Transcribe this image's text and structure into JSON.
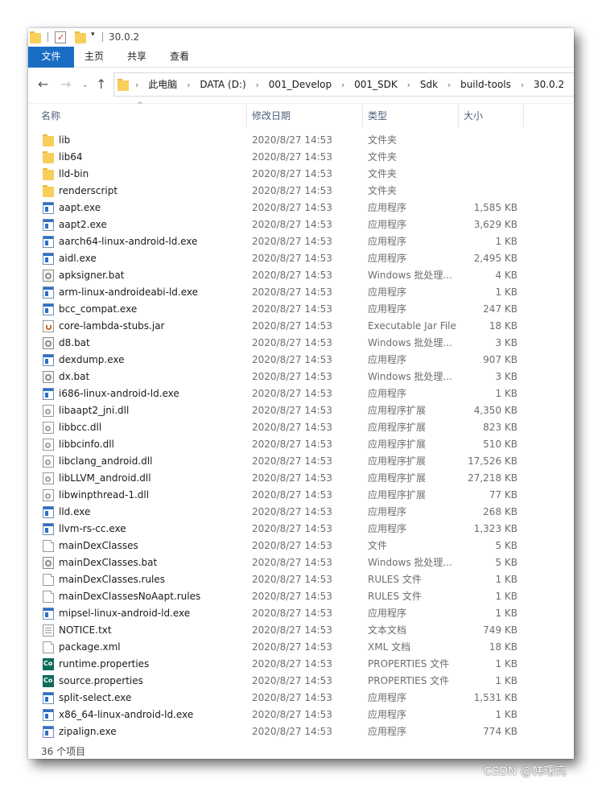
{
  "window": {
    "title": "30.0.2"
  },
  "ribbon": {
    "tabs": [
      {
        "label": "文件"
      },
      {
        "label": "主页"
      },
      {
        "label": "共享"
      },
      {
        "label": "查看"
      }
    ]
  },
  "address": {
    "crumbs": [
      "此电脑",
      "DATA (D:)",
      "001_Develop",
      "001_SDK",
      "Sdk",
      "build-tools",
      "30.0.2"
    ]
  },
  "columns": {
    "name": "名称",
    "date": "修改日期",
    "type": "类型",
    "size": "大小"
  },
  "files": [
    {
      "name": "lib",
      "date": "2020/8/27 14:53",
      "type": "文件夹",
      "size": "",
      "icon": "folder-icon"
    },
    {
      "name": "lib64",
      "date": "2020/8/27 14:53",
      "type": "文件夹",
      "size": "",
      "icon": "folder-icon"
    },
    {
      "name": "lld-bin",
      "date": "2020/8/27 14:53",
      "type": "文件夹",
      "size": "",
      "icon": "folder-icon"
    },
    {
      "name": "renderscript",
      "date": "2020/8/27 14:53",
      "type": "文件夹",
      "size": "",
      "icon": "folder-icon"
    },
    {
      "name": "aapt.exe",
      "date": "2020/8/27 14:53",
      "type": "应用程序",
      "size": "1,585 KB",
      "icon": "exe-icon"
    },
    {
      "name": "aapt2.exe",
      "date": "2020/8/27 14:53",
      "type": "应用程序",
      "size": "3,629 KB",
      "icon": "exe-icon"
    },
    {
      "name": "aarch64-linux-android-ld.exe",
      "date": "2020/8/27 14:53",
      "type": "应用程序",
      "size": "1 KB",
      "icon": "exe-icon"
    },
    {
      "name": "aidl.exe",
      "date": "2020/8/27 14:53",
      "type": "应用程序",
      "size": "2,495 KB",
      "icon": "exe-icon"
    },
    {
      "name": "apksigner.bat",
      "date": "2020/8/27 14:53",
      "type": "Windows 批处理...",
      "size": "4 KB",
      "icon": "bat-icon"
    },
    {
      "name": "arm-linux-androideabi-ld.exe",
      "date": "2020/8/27 14:53",
      "type": "应用程序",
      "size": "1 KB",
      "icon": "exe-icon"
    },
    {
      "name": "bcc_compat.exe",
      "date": "2020/8/27 14:53",
      "type": "应用程序",
      "size": "247 KB",
      "icon": "exe-icon"
    },
    {
      "name": "core-lambda-stubs.jar",
      "date": "2020/8/27 14:53",
      "type": "Executable Jar File",
      "size": "18 KB",
      "icon": "jar-icon"
    },
    {
      "name": "d8.bat",
      "date": "2020/8/27 14:53",
      "type": "Windows 批处理...",
      "size": "3 KB",
      "icon": "bat-icon"
    },
    {
      "name": "dexdump.exe",
      "date": "2020/8/27 14:53",
      "type": "应用程序",
      "size": "907 KB",
      "icon": "exe-icon"
    },
    {
      "name": "dx.bat",
      "date": "2020/8/27 14:53",
      "type": "Windows 批处理...",
      "size": "3 KB",
      "icon": "bat-icon"
    },
    {
      "name": "i686-linux-android-ld.exe",
      "date": "2020/8/27 14:53",
      "type": "应用程序",
      "size": "1 KB",
      "icon": "exe-icon"
    },
    {
      "name": "libaapt2_jni.dll",
      "date": "2020/8/27 14:53",
      "type": "应用程序扩展",
      "size": "4,350 KB",
      "icon": "dll-icon"
    },
    {
      "name": "libbcc.dll",
      "date": "2020/8/27 14:53",
      "type": "应用程序扩展",
      "size": "823 KB",
      "icon": "dll-icon"
    },
    {
      "name": "libbcinfo.dll",
      "date": "2020/8/27 14:53",
      "type": "应用程序扩展",
      "size": "510 KB",
      "icon": "dll-icon"
    },
    {
      "name": "libclang_android.dll",
      "date": "2020/8/27 14:53",
      "type": "应用程序扩展",
      "size": "17,526 KB",
      "icon": "dll-icon"
    },
    {
      "name": "libLLVM_android.dll",
      "date": "2020/8/27 14:53",
      "type": "应用程序扩展",
      "size": "27,218 KB",
      "icon": "dll-icon"
    },
    {
      "name": "libwinpthread-1.dll",
      "date": "2020/8/27 14:53",
      "type": "应用程序扩展",
      "size": "77 KB",
      "icon": "dll-icon"
    },
    {
      "name": "lld.exe",
      "date": "2020/8/27 14:53",
      "type": "应用程序",
      "size": "268 KB",
      "icon": "exe-icon"
    },
    {
      "name": "llvm-rs-cc.exe",
      "date": "2020/8/27 14:53",
      "type": "应用程序",
      "size": "1,323 KB",
      "icon": "exe-icon"
    },
    {
      "name": "mainDexClasses",
      "date": "2020/8/27 14:53",
      "type": "文件",
      "size": "5 KB",
      "icon": "file-icon"
    },
    {
      "name": "mainDexClasses.bat",
      "date": "2020/8/27 14:53",
      "type": "Windows 批处理...",
      "size": "5 KB",
      "icon": "bat-icon"
    },
    {
      "name": "mainDexClasses.rules",
      "date": "2020/8/27 14:53",
      "type": "RULES 文件",
      "size": "1 KB",
      "icon": "file-icon"
    },
    {
      "name": "mainDexClassesNoAapt.rules",
      "date": "2020/8/27 14:53",
      "type": "RULES 文件",
      "size": "1 KB",
      "icon": "file-icon"
    },
    {
      "name": "mipsel-linux-android-ld.exe",
      "date": "2020/8/27 14:53",
      "type": "应用程序",
      "size": "1 KB",
      "icon": "exe-icon"
    },
    {
      "name": "NOTICE.txt",
      "date": "2020/8/27 14:53",
      "type": "文本文档",
      "size": "749 KB",
      "icon": "txt-icon"
    },
    {
      "name": "package.xml",
      "date": "2020/8/27 14:53",
      "type": "XML 文档",
      "size": "18 KB",
      "icon": "file-icon"
    },
    {
      "name": "runtime.properties",
      "date": "2020/8/27 14:53",
      "type": "PROPERTIES 文件",
      "size": "1 KB",
      "icon": "properties-icon"
    },
    {
      "name": "source.properties",
      "date": "2020/8/27 14:53",
      "type": "PROPERTIES 文件",
      "size": "1 KB",
      "icon": "properties-icon"
    },
    {
      "name": "split-select.exe",
      "date": "2020/8/27 14:53",
      "type": "应用程序",
      "size": "1,531 KB",
      "icon": "exe-icon"
    },
    {
      "name": "x86_64-linux-android-ld.exe",
      "date": "2020/8/27 14:53",
      "type": "应用程序",
      "size": "1 KB",
      "icon": "exe-icon"
    },
    {
      "name": "zipalign.exe",
      "date": "2020/8/27 14:53",
      "type": "应用程序",
      "size": "774 KB",
      "icon": "exe-icon"
    }
  ],
  "status": {
    "item_count": "36 个项目"
  },
  "watermark": "CSDN @韩曙亮",
  "colors": {
    "file_tab": "#1a6dc5",
    "folder": "#f7cf5a",
    "column_header_text": "#4c607a",
    "secondary_text": "#6d6d6d"
  }
}
